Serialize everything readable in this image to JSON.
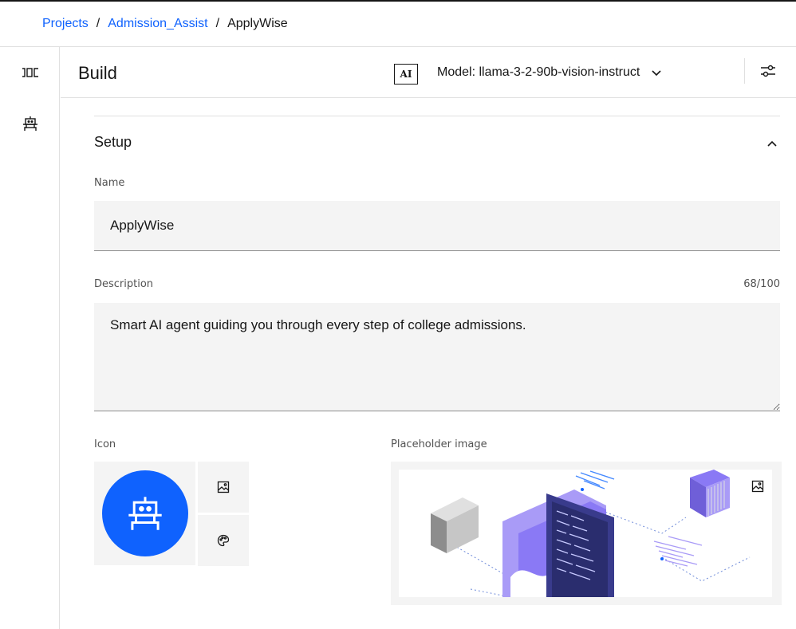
{
  "breadcrumb": {
    "items": [
      "Projects",
      "Admission_Assist"
    ],
    "separator": "/",
    "current": "ApplyWise"
  },
  "left_rail": {
    "icons": [
      "compare-icon",
      "robot-icon"
    ]
  },
  "header": {
    "title": "Build",
    "ai_badge": "AI",
    "model_label": "Model: llama-3-2-90b-vision-instruct",
    "settings_icon": "settings-adjust-icon"
  },
  "setup": {
    "title": "Setup",
    "name": {
      "label": "Name",
      "value": "ApplyWise"
    },
    "description": {
      "label": "Description",
      "value": "Smart AI agent guiding you through every step of college admissions.",
      "counter": "68/100"
    },
    "icon": {
      "label": "Icon",
      "avatar": "robot-icon",
      "actions": [
        "image-icon",
        "color-palette-icon"
      ]
    },
    "placeholder_image": {
      "label": "Placeholder image",
      "action": "image-icon"
    }
  },
  "colors": {
    "link": "#0f62fe",
    "avatar_bg": "#0f62fe",
    "field_bg": "#f4f4f4",
    "illustration_purple": "#8a79f5"
  }
}
